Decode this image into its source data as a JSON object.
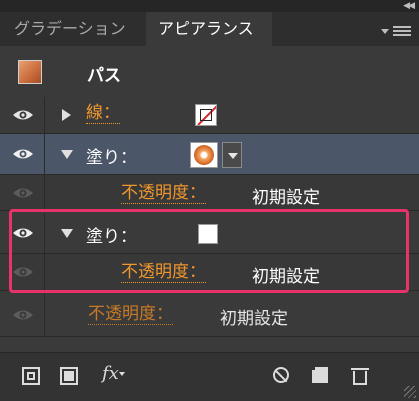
{
  "panel": {
    "collapse_icon": "double-chevron-left-icon",
    "tabs": [
      {
        "label": "グラデーション",
        "active": false
      },
      {
        "label": "アピアランス",
        "active": true
      }
    ],
    "menu_icon": "panel-menu-icon"
  },
  "header": {
    "title": "パス",
    "thumbnail_icon": "gradient-thumbnail-icon"
  },
  "rows": {
    "stroke": {
      "label": "線：",
      "swatch": "none-stroke-swatch-icon"
    },
    "fill1": {
      "label": "塗り：",
      "swatch": "radial-gradient-swatch-icon"
    },
    "fill1_opacity": {
      "label": "不透明度：",
      "value": "初期設定"
    },
    "fill2": {
      "label": "塗り：",
      "swatch": "white-swatch-icon"
    },
    "fill2_opacity": {
      "label": "不透明度：",
      "value": "初期設定"
    },
    "object_opacity": {
      "label": "不透明度：",
      "value": "初期設定"
    }
  },
  "toolbar": {
    "fx_label": "fx",
    "icons": [
      "add-new-stroke-icon",
      "add-new-fill-icon",
      "fx-icon",
      "clear-appearance-icon",
      "duplicate-item-icon",
      "trash-icon"
    ]
  },
  "colors": {
    "accent_link": "#f0972e",
    "selected_row": "#4b5668",
    "highlight": "#e8336a"
  }
}
